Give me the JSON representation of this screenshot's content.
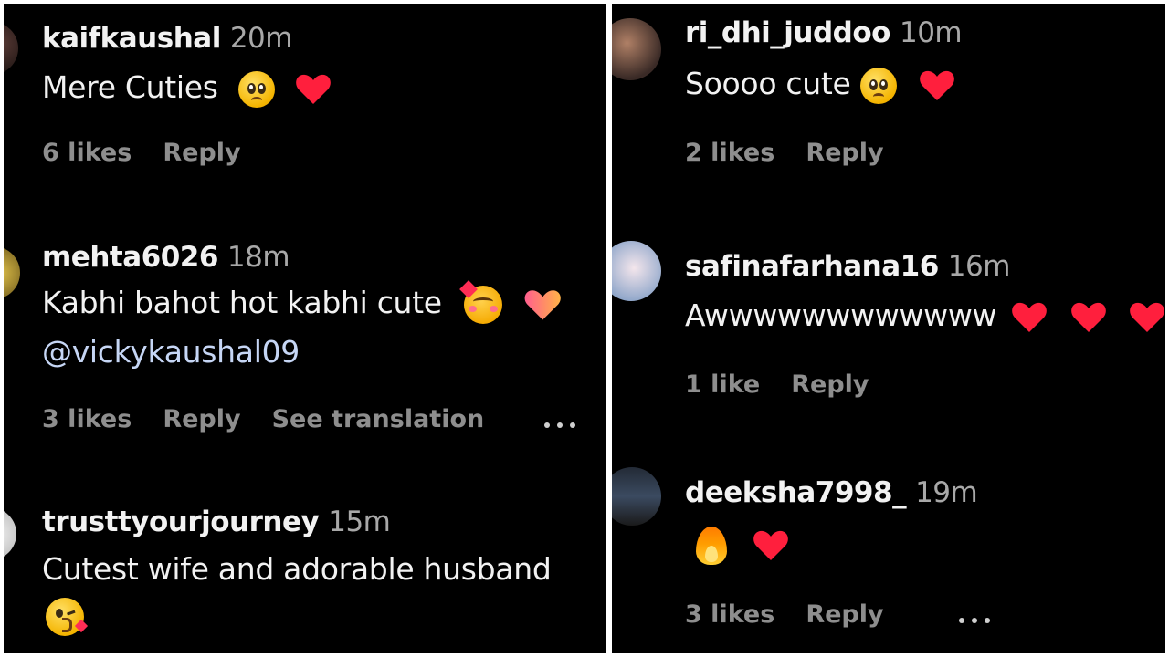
{
  "left": {
    "comments": [
      {
        "username": "kaifkaushal",
        "time": "20m",
        "text": "Mere Cuties",
        "likes": "6 likes",
        "reply": "Reply"
      },
      {
        "username": "mehta6026",
        "time": "18m",
        "text": "Kabhi bahot hot kabhi cute",
        "mention": "@vickykaushal09",
        "likes": "3 likes",
        "reply": "Reply",
        "translate": "See translation"
      },
      {
        "username": "trusttyourjourney",
        "time": "15m",
        "text": "Cutest wife and adorable husband"
      }
    ]
  },
  "right": {
    "comments": [
      {
        "username": "ri_dhi_juddoo",
        "time": "10m",
        "text": "Soooo cute",
        "likes": "2 likes",
        "reply": "Reply"
      },
      {
        "username": "safinafarhana16",
        "time": "16m",
        "text": "Awwwwwwwwwwww",
        "likes": "1 like",
        "reply": "Reply"
      },
      {
        "username": "deeksha7998_",
        "time": "19m",
        "text": "",
        "likes": "3 likes",
        "reply": "Reply"
      }
    ]
  },
  "colors": {
    "background": "#000000",
    "text": "#f2f2f2",
    "muted": "#8e8e8e",
    "mention": "#c6d6f5",
    "heart": "#ff1f3d"
  },
  "icons": [
    "pleading-face-icon",
    "red-heart-icon",
    "smiling-face-with-hearts-icon",
    "heart-with-ribbon-icon",
    "face-blowing-kiss-icon",
    "fire-icon",
    "more-options-icon"
  ]
}
